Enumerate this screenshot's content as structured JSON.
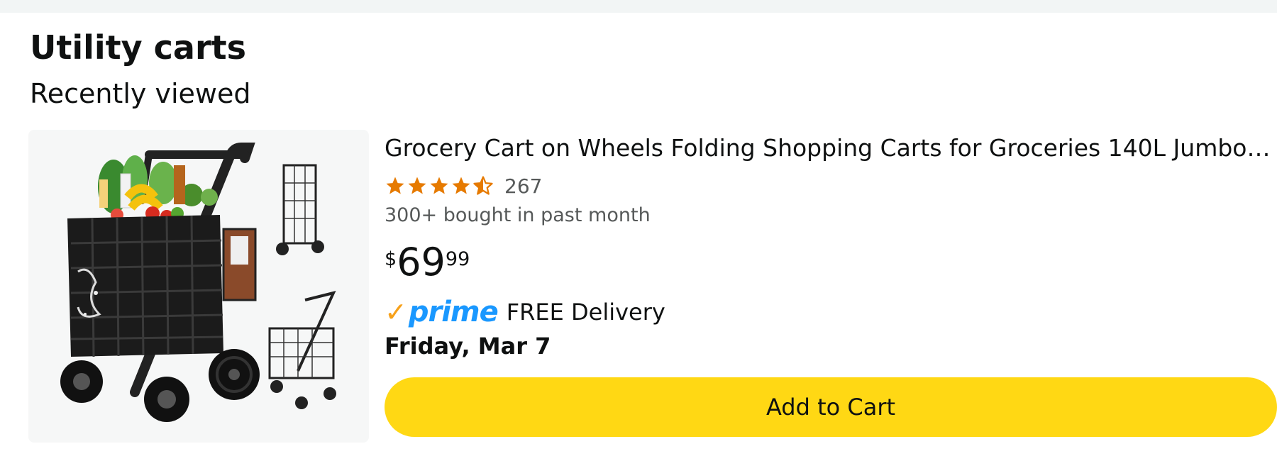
{
  "section": {
    "title": "Utility carts",
    "subtitle": "Recently viewed"
  },
  "product": {
    "title": "Grocery Cart on Wheels Folding Shopping Carts for Groceries 140L Jumbo with…",
    "rating": 4.5,
    "rating_max": 5,
    "review_count": "267",
    "bought_text": "300+ bought in past month",
    "price": {
      "symbol": "$",
      "whole": "69",
      "fraction": "99"
    },
    "prime_label": "prime",
    "delivery_text": "FREE Delivery",
    "delivery_date": "Friday, Mar 7",
    "add_to_cart_label": "Add to Cart"
  },
  "colors": {
    "star": "#e67a00",
    "prime_check": "#f7a11a",
    "prime_text": "#1a98ff",
    "button_bg": "#ffd814",
    "secondary_text": "#565959"
  },
  "icons": {
    "star": "star-icon",
    "half_star": "half-star-icon",
    "prime_check": "prime-check-icon"
  }
}
